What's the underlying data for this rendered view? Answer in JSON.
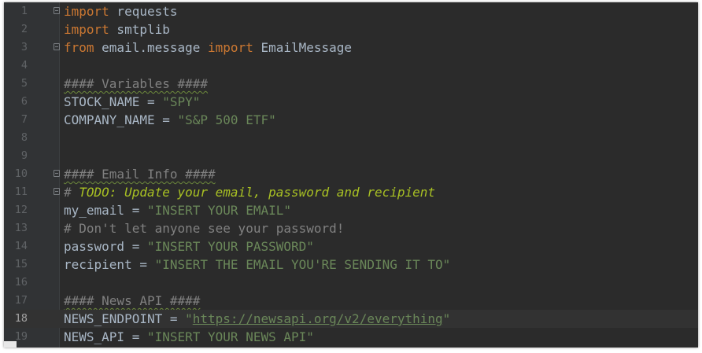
{
  "editor": {
    "current_line": "18",
    "lines": [
      {
        "num": "1",
        "tokens": [
          {
            "t": "import",
            "c": "kw"
          },
          {
            "t": " requests",
            "c": ""
          }
        ],
        "fold": true
      },
      {
        "num": "2",
        "tokens": [
          {
            "t": "import",
            "c": "kw"
          },
          {
            "t": " smtplib",
            "c": ""
          }
        ]
      },
      {
        "num": "3",
        "tokens": [
          {
            "t": "from",
            "c": "kw"
          },
          {
            "t": " email.message ",
            "c": ""
          },
          {
            "t": "import",
            "c": "kw"
          },
          {
            "t": " EmailMessage",
            "c": ""
          }
        ],
        "fold": true
      },
      {
        "num": "4",
        "tokens": []
      },
      {
        "num": "5",
        "tokens": [
          {
            "t": "#### Variables ####",
            "c": "cm wavy"
          }
        ]
      },
      {
        "num": "6",
        "tokens": [
          {
            "t": "STOCK_NAME = ",
            "c": ""
          },
          {
            "t": "\"SPY\"",
            "c": "str"
          }
        ]
      },
      {
        "num": "7",
        "tokens": [
          {
            "t": "COMPANY_NAME = ",
            "c": ""
          },
          {
            "t": "\"S&P 500 ETF\"",
            "c": "str"
          }
        ]
      },
      {
        "num": "8",
        "tokens": []
      },
      {
        "num": "9",
        "tokens": []
      },
      {
        "num": "10",
        "tokens": [
          {
            "t": "#### Email Info ####",
            "c": "cm wavy"
          }
        ],
        "fold": true
      },
      {
        "num": "11",
        "tokens": [
          {
            "t": "# ",
            "c": "cm"
          },
          {
            "t": "TODO: Update your email, password and recipient",
            "c": "todo"
          }
        ],
        "fold": true
      },
      {
        "num": "12",
        "tokens": [
          {
            "t": "my_email = ",
            "c": ""
          },
          {
            "t": "\"INSERT YOUR EMAIL\"",
            "c": "str"
          }
        ]
      },
      {
        "num": "13",
        "tokens": [
          {
            "t": "# Don't let anyone see your password!",
            "c": "cm"
          }
        ]
      },
      {
        "num": "14",
        "tokens": [
          {
            "t": "password = ",
            "c": ""
          },
          {
            "t": "\"INSERT YOUR PASSWORD\"",
            "c": "str"
          }
        ]
      },
      {
        "num": "15",
        "tokens": [
          {
            "t": "recipient = ",
            "c": ""
          },
          {
            "t": "\"INSERT THE EMAIL YOU'RE SENDING IT TO\"",
            "c": "str"
          }
        ]
      },
      {
        "num": "16",
        "tokens": []
      },
      {
        "num": "17",
        "tokens": [
          {
            "t": "#### News API ####",
            "c": "cm wavy"
          }
        ]
      },
      {
        "num": "18",
        "tokens": [
          {
            "t": "NEWS_ENDPOINT = ",
            "c": ""
          },
          {
            "t": "\"",
            "c": "str"
          },
          {
            "t": "https://newsapi.org/v2/everything",
            "c": "link"
          },
          {
            "t": "\"",
            "c": "str"
          }
        ]
      },
      {
        "num": "19",
        "tokens": [
          {
            "t": "NEWS_API = ",
            "c": ""
          },
          {
            "t": "\"INSERT YOUR NEWS API\"",
            "c": "str"
          }
        ]
      }
    ]
  },
  "colors": {
    "background": "#2b2b2b",
    "keyword": "#cc7832",
    "string": "#6a8759",
    "comment": "#808080",
    "todo": "#a8c023",
    "identifier": "#a9b7c6"
  }
}
